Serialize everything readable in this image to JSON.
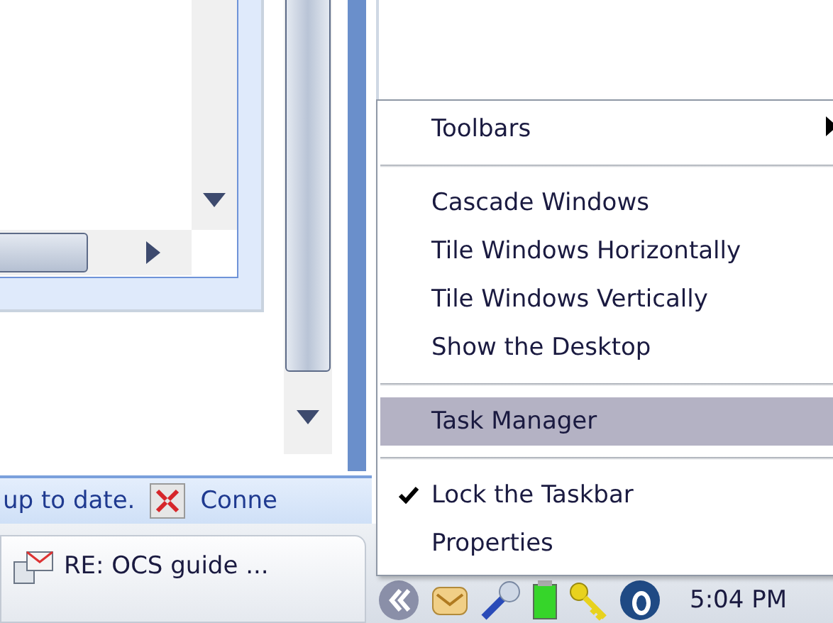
{
  "status_bar": {
    "items": [
      {
        "kind": "text",
        "text": "up to date."
      },
      {
        "kind": "icon_text",
        "text": "Conne"
      }
    ]
  },
  "context_menu": {
    "items": [
      {
        "kind": "item",
        "label": "Toolbars",
        "submenu": true,
        "checked": false,
        "selected": false
      },
      {
        "kind": "separator"
      },
      {
        "kind": "item",
        "label": "Cascade Windows",
        "submenu": false,
        "checked": false,
        "selected": false
      },
      {
        "kind": "item",
        "label": "Tile Windows Horizontally",
        "submenu": false,
        "checked": false,
        "selected": false
      },
      {
        "kind": "item",
        "label": "Tile Windows Vertically",
        "submenu": false,
        "checked": false,
        "selected": false
      },
      {
        "kind": "item",
        "label": "Show the Desktop",
        "submenu": false,
        "checked": false,
        "selected": false
      },
      {
        "kind": "separator"
      },
      {
        "kind": "item",
        "label": "Task Manager",
        "submenu": false,
        "checked": false,
        "selected": true
      },
      {
        "kind": "separator"
      },
      {
        "kind": "item",
        "label": "Lock the Taskbar",
        "submenu": false,
        "checked": true,
        "selected": false
      },
      {
        "kind": "item",
        "label": "Properties",
        "submenu": false,
        "checked": false,
        "selected": false
      }
    ]
  },
  "taskbar": {
    "buttons": [
      {
        "label": "RE: OCS guide ..."
      }
    ],
    "clock": "5:04 PM"
  }
}
